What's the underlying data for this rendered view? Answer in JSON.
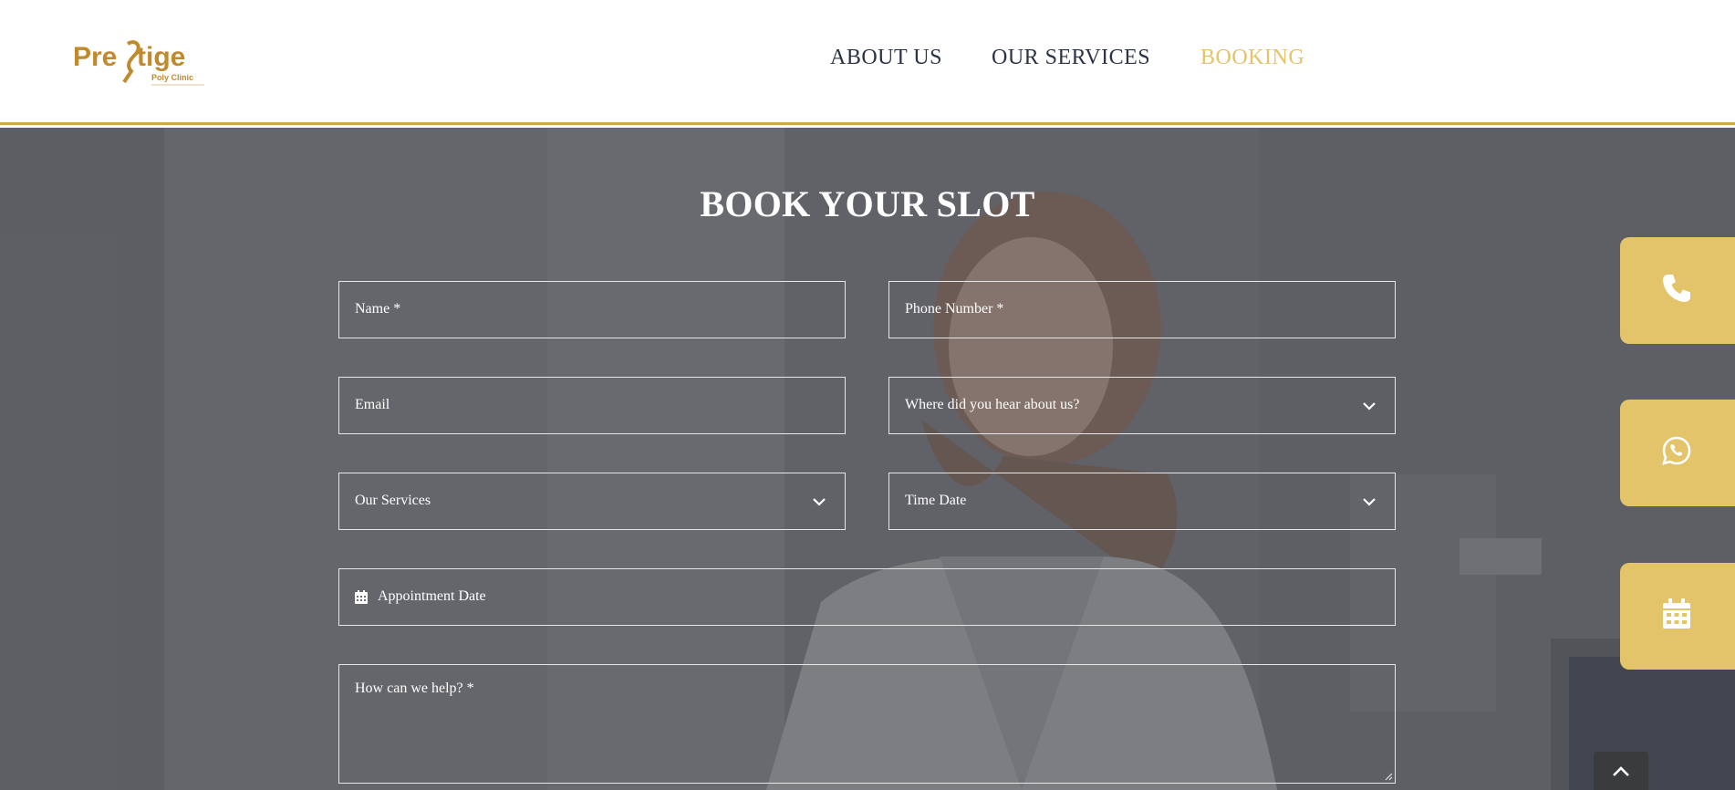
{
  "brand": {
    "name_part1": "Pre",
    "name_part2": "tige",
    "tagline": "Poly Clinic",
    "logo_color": "#c08a2e"
  },
  "nav": {
    "items": [
      {
        "label": "ABOUT US",
        "active": false
      },
      {
        "label": "OUR SERVICES",
        "active": false
      },
      {
        "label": "BOOKING",
        "active": true
      }
    ]
  },
  "form": {
    "title": "BOOK YOUR SLOT",
    "name_placeholder": "Name *",
    "phone_placeholder": "Phone Number *",
    "email_placeholder": "Email",
    "hear_placeholder": "Where did you hear about us?",
    "services_placeholder": "Our Services",
    "time_placeholder": "Time Date",
    "date_placeholder": "Appointment Date",
    "help_placeholder": "How can we help? *"
  },
  "side_buttons": [
    {
      "icon": "phone-icon"
    },
    {
      "icon": "whatsapp-icon"
    },
    {
      "icon": "calendar-icon"
    }
  ],
  "colors": {
    "accent": "#e3c46a",
    "nav_text": "#2b3346",
    "header_border": "#d4a54a"
  }
}
